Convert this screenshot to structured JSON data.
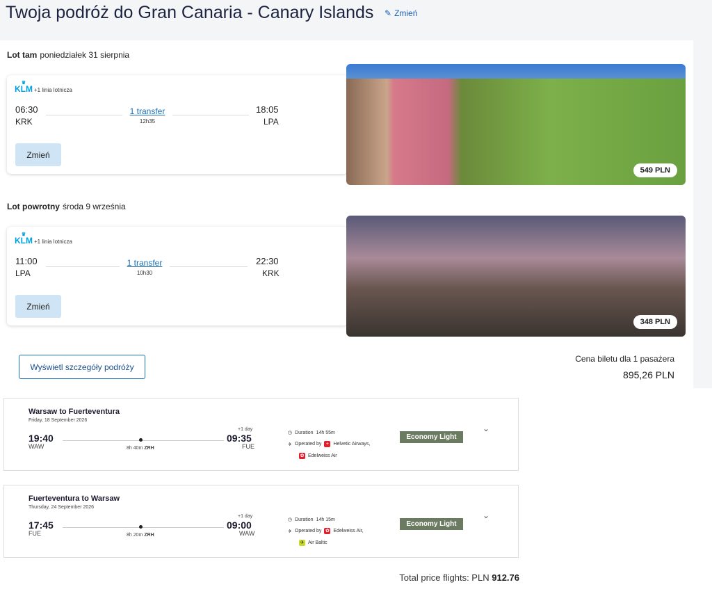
{
  "header": {
    "title": "Twoja podróż do Gran Canaria - Canary Islands",
    "edit_label": "Zmień"
  },
  "legs": [
    {
      "label": "Lot tam",
      "date": "poniedziałek 31 sierpnia",
      "airline": "KLM",
      "extra_airlines": "+1 linia lotnicza",
      "dep_time": "06:30",
      "dep_airport": "KRK",
      "arr_time": "18:05",
      "arr_airport": "LPA",
      "transfer": "1 transfer",
      "duration": "12h35",
      "change_label": "Zmień",
      "price": "549 PLN"
    },
    {
      "label": "Lot powrotny",
      "date": "środa 9 września",
      "airline": "KLM",
      "extra_airlines": "+1 linia lotnicza",
      "dep_time": "11:00",
      "dep_airport": "LPA",
      "arr_time": "22:30",
      "arr_airport": "KRK",
      "transfer": "1 transfer",
      "duration": "10h30",
      "change_label": "Zmień",
      "price": "348 PLN"
    }
  ],
  "details_button": "Wyświetl szczegóły podróży",
  "price_label": "Cena biletu dla 1 pasażera",
  "price_value": "895,26 PLN",
  "flights": [
    {
      "route": "Warsaw to Fuerteventura",
      "date": "Friday, 18 September 2026",
      "dep_time": "19:40",
      "dep_airport": "WAW",
      "arr_time": "09:35",
      "arr_airport": "FUE",
      "plus_day": "+1 day",
      "stop_duration": "8h 40m",
      "stop_airport": "ZRH",
      "duration_label": "Duration",
      "duration": "14h 55m",
      "operated_label": "Operated by",
      "operators": [
        "Helvetic Airways,",
        "Edelweiss Air"
      ],
      "fare": "Economy Light"
    },
    {
      "route": "Fuerteventura to Warsaw",
      "date": "Thursday, 24 September 2026",
      "dep_time": "17:45",
      "dep_airport": "FUE",
      "arr_time": "09:00",
      "arr_airport": "WAW",
      "plus_day": "+1 day",
      "stop_duration": "8h 20m",
      "stop_airport": "ZRH",
      "duration_label": "Duration",
      "duration": "14h 15m",
      "operated_label": "Operated by",
      "operators": [
        "Edelweiss Air,",
        "Air Baltic"
      ],
      "fare": "Economy Light"
    }
  ],
  "total": {
    "label": "Total price flights: PLN",
    "value": "912.76"
  }
}
